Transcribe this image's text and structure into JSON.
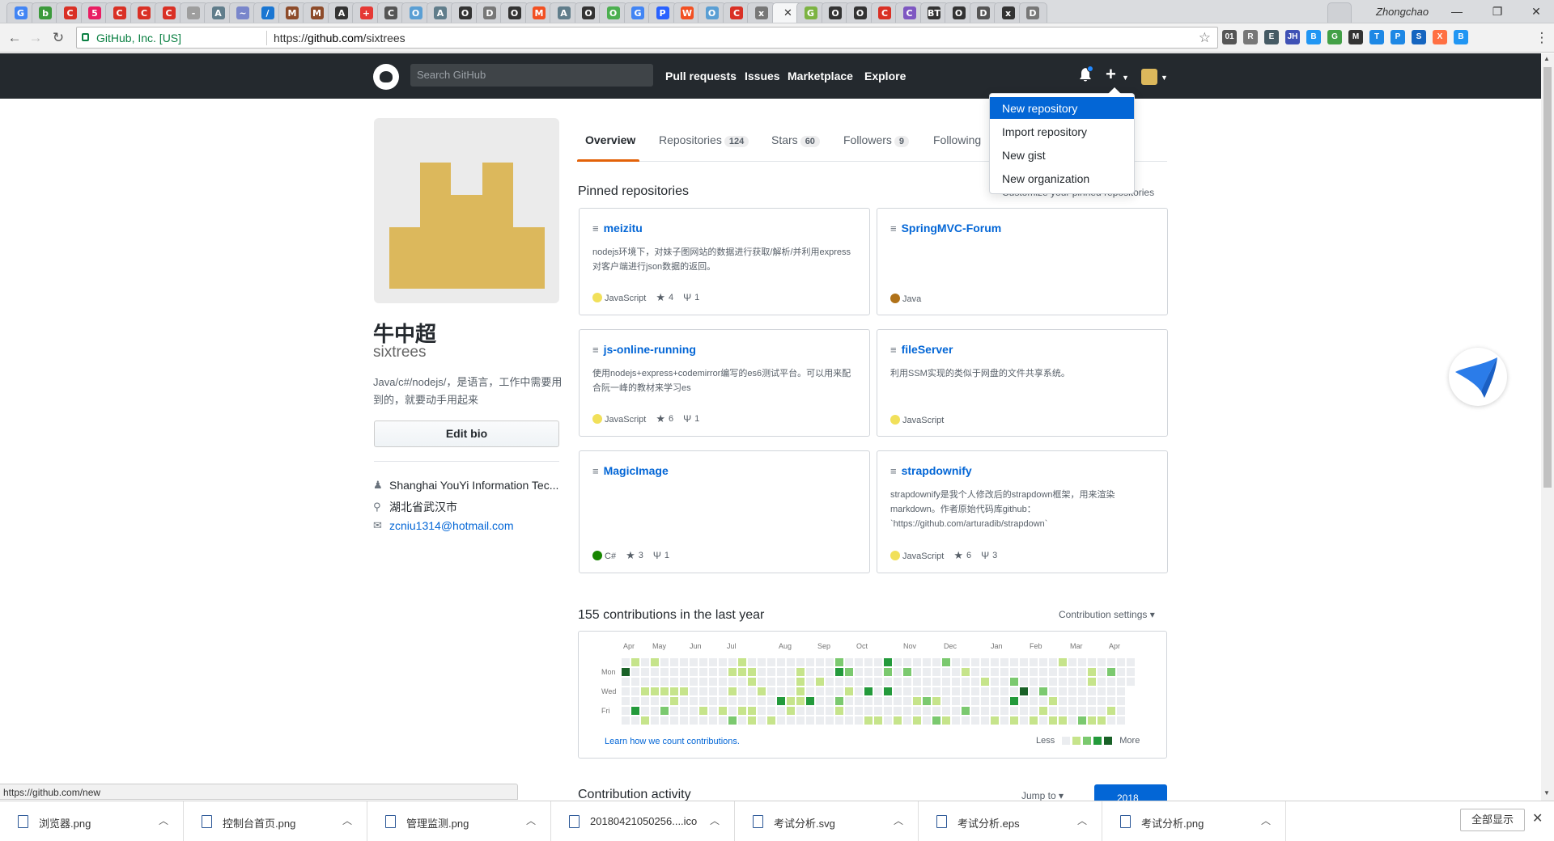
{
  "browser": {
    "profile_name": "Zhongchao",
    "tab_count": 31,
    "secure_label": "GitHub, Inc. [US]",
    "url_scheme": "https://",
    "url_host": "github.com",
    "url_path": "/sixtrees",
    "status_url": "https://github.com/new",
    "favicons": [
      "G",
      "b",
      "C",
      "5",
      "C",
      "C",
      "C",
      "-",
      "A",
      "~",
      "/",
      "M",
      "M",
      "A",
      "+",
      "C",
      "O",
      "A",
      "O",
      "D",
      "O",
      "M",
      "A",
      "O",
      "O",
      "G",
      "P",
      "W",
      "O",
      "C",
      "x",
      "C",
      "G",
      "O",
      "O",
      "C",
      "C",
      "BT",
      "O",
      "D",
      "x",
      "D"
    ],
    "extension_icons": [
      "01",
      "R",
      "E",
      "JH",
      "B",
      "G",
      "M",
      "T",
      "P",
      "S",
      "X",
      "B"
    ]
  },
  "gh_header": {
    "search_placeholder": "Search GitHub",
    "nav": [
      "Pull requests",
      "Issues",
      "Marketplace",
      "Explore"
    ]
  },
  "new_menu": {
    "items": [
      "New repository",
      "Import repository",
      "New gist",
      "New organization"
    ],
    "selected_index": 0
  },
  "profile": {
    "fullname": "牛中超",
    "username": "sixtrees",
    "bio": "Java/c#/nodejs/，是语言，工作中需要用到的，就要动手用起来",
    "edit_bio_label": "Edit bio",
    "company": "Shanghai YouYi Information Tec...",
    "location": "湖北省武汉市",
    "email": "zcniu1314@hotmail.com"
  },
  "tabs": [
    {
      "label": "Overview",
      "count": ""
    },
    {
      "label": "Repositories",
      "count": "124"
    },
    {
      "label": "Stars",
      "count": "60"
    },
    {
      "label": "Followers",
      "count": "9"
    },
    {
      "label": "Following",
      "count": ""
    }
  ],
  "pinned": {
    "title": "Pinned repositories",
    "customize": "Customize your pinned repositories",
    "repos": [
      {
        "name": "meizitu",
        "desc": "nodejs环境下，对妹子图网站的数据进行获取/解析/并利用express对客户端进行json数据的返回。",
        "lang": "JavaScript",
        "lang_color": "#f1e05a",
        "stars": "4",
        "forks": "1"
      },
      {
        "name": "SpringMVC-Forum",
        "desc": "",
        "lang": "Java",
        "lang_color": "#b07219",
        "stars": "",
        "forks": ""
      },
      {
        "name": "js-online-running",
        "desc": "使用nodejs+express+codemirror编写的es6测试平台。可以用来配合阮一峰的教材来学习es",
        "lang": "JavaScript",
        "lang_color": "#f1e05a",
        "stars": "6",
        "forks": "1"
      },
      {
        "name": "fileServer",
        "desc": "利用SSM实现的类似于网盘的文件共享系统。",
        "lang": "JavaScript",
        "lang_color": "#f1e05a",
        "stars": "",
        "forks": ""
      },
      {
        "name": "MagicImage",
        "desc": "",
        "lang": "C#",
        "lang_color": "#178600",
        "stars": "3",
        "forks": "1"
      },
      {
        "name": "strapdownify",
        "desc": "strapdownify是我个人修改后的strapdown框架，用来渲染markdown。作者原始代码库github：`https://github.com/arturadib/strapdown`",
        "lang": "JavaScript",
        "lang_color": "#f1e05a",
        "stars": "6",
        "forks": "3"
      }
    ]
  },
  "contributions": {
    "title": "155 contributions in the last year",
    "settings": "Contribution settings",
    "months": [
      "Apr",
      "May",
      "Jun",
      "Jul",
      "Aug",
      "Sep",
      "Oct",
      "Nov",
      "Dec",
      "Jan",
      "Feb",
      "Mar",
      "Apr"
    ],
    "day_labels": [
      "Mon",
      "Wed",
      "Fri"
    ],
    "learn": "Learn how we count contributions.",
    "less": "Less",
    "more": "More",
    "level_colors": [
      "#ebedf0",
      "#c6e48b",
      "#7bc96f",
      "#239a3b",
      "#196127"
    ]
  },
  "activity": {
    "title": "Contribution activity",
    "jump_to": "Jump to",
    "year": "2018"
  },
  "downloads": {
    "files": [
      "浏览器.png",
      "控制台首页.png",
      "管理监测.png",
      "20180421050256....ico",
      "考试分析.svg",
      "考试分析.eps",
      "考试分析.png"
    ],
    "show_all": "全部显示"
  }
}
